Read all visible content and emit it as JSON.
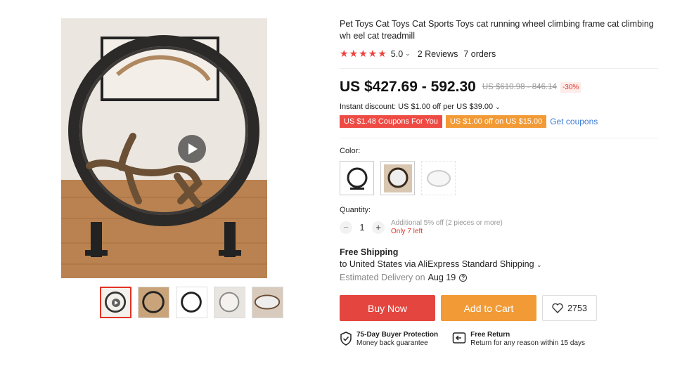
{
  "product": {
    "title": "Pet Toys Cat Toys Cat Sports Toys cat running wheel climbing frame cat climbing wh eel cat treadmill",
    "rating": "5.0",
    "reviews": "2 Reviews",
    "orders": "7 orders"
  },
  "price": {
    "current": "US $427.69 - 592.30",
    "original": "US $610.98 - 846.14",
    "discount": "-30%"
  },
  "promo": {
    "instant": "Instant discount: US $1.00 off per US $39.00",
    "coupon1": "US $1.48 Coupons For You",
    "coupon2": "US $1.00 off on US $15.00",
    "get_coupons": "Get coupons"
  },
  "color": {
    "label": "Color:"
  },
  "quantity": {
    "label": "Quantity:",
    "value": "1",
    "minus": "−",
    "plus": "+",
    "note": "Additional 5% off (2 pieces or more)",
    "stock": "Only 7 left"
  },
  "shipping": {
    "title": "Free Shipping",
    "line": "to United States via AliExpress Standard Shipping",
    "estimated_label": "Estimated Delivery on",
    "date": "Aug 19"
  },
  "actions": {
    "buy": "Buy Now",
    "cart": "Add to Cart",
    "wishlist_count": "2753"
  },
  "guarantee": {
    "protection_title": "75-Day Buyer Protection",
    "protection_sub": "Money back guarantee",
    "return_title": "Free Return",
    "return_sub": "Return for any reason within 15 days"
  },
  "icons": [
    "play-icon",
    "star-icon",
    "chevron-down-icon",
    "help-icon",
    "heart-icon",
    "shield-check-icon",
    "return-icon"
  ],
  "colors": {
    "accent": "#e4463f",
    "orange": "#f29b36",
    "link": "#3a7bd5"
  }
}
